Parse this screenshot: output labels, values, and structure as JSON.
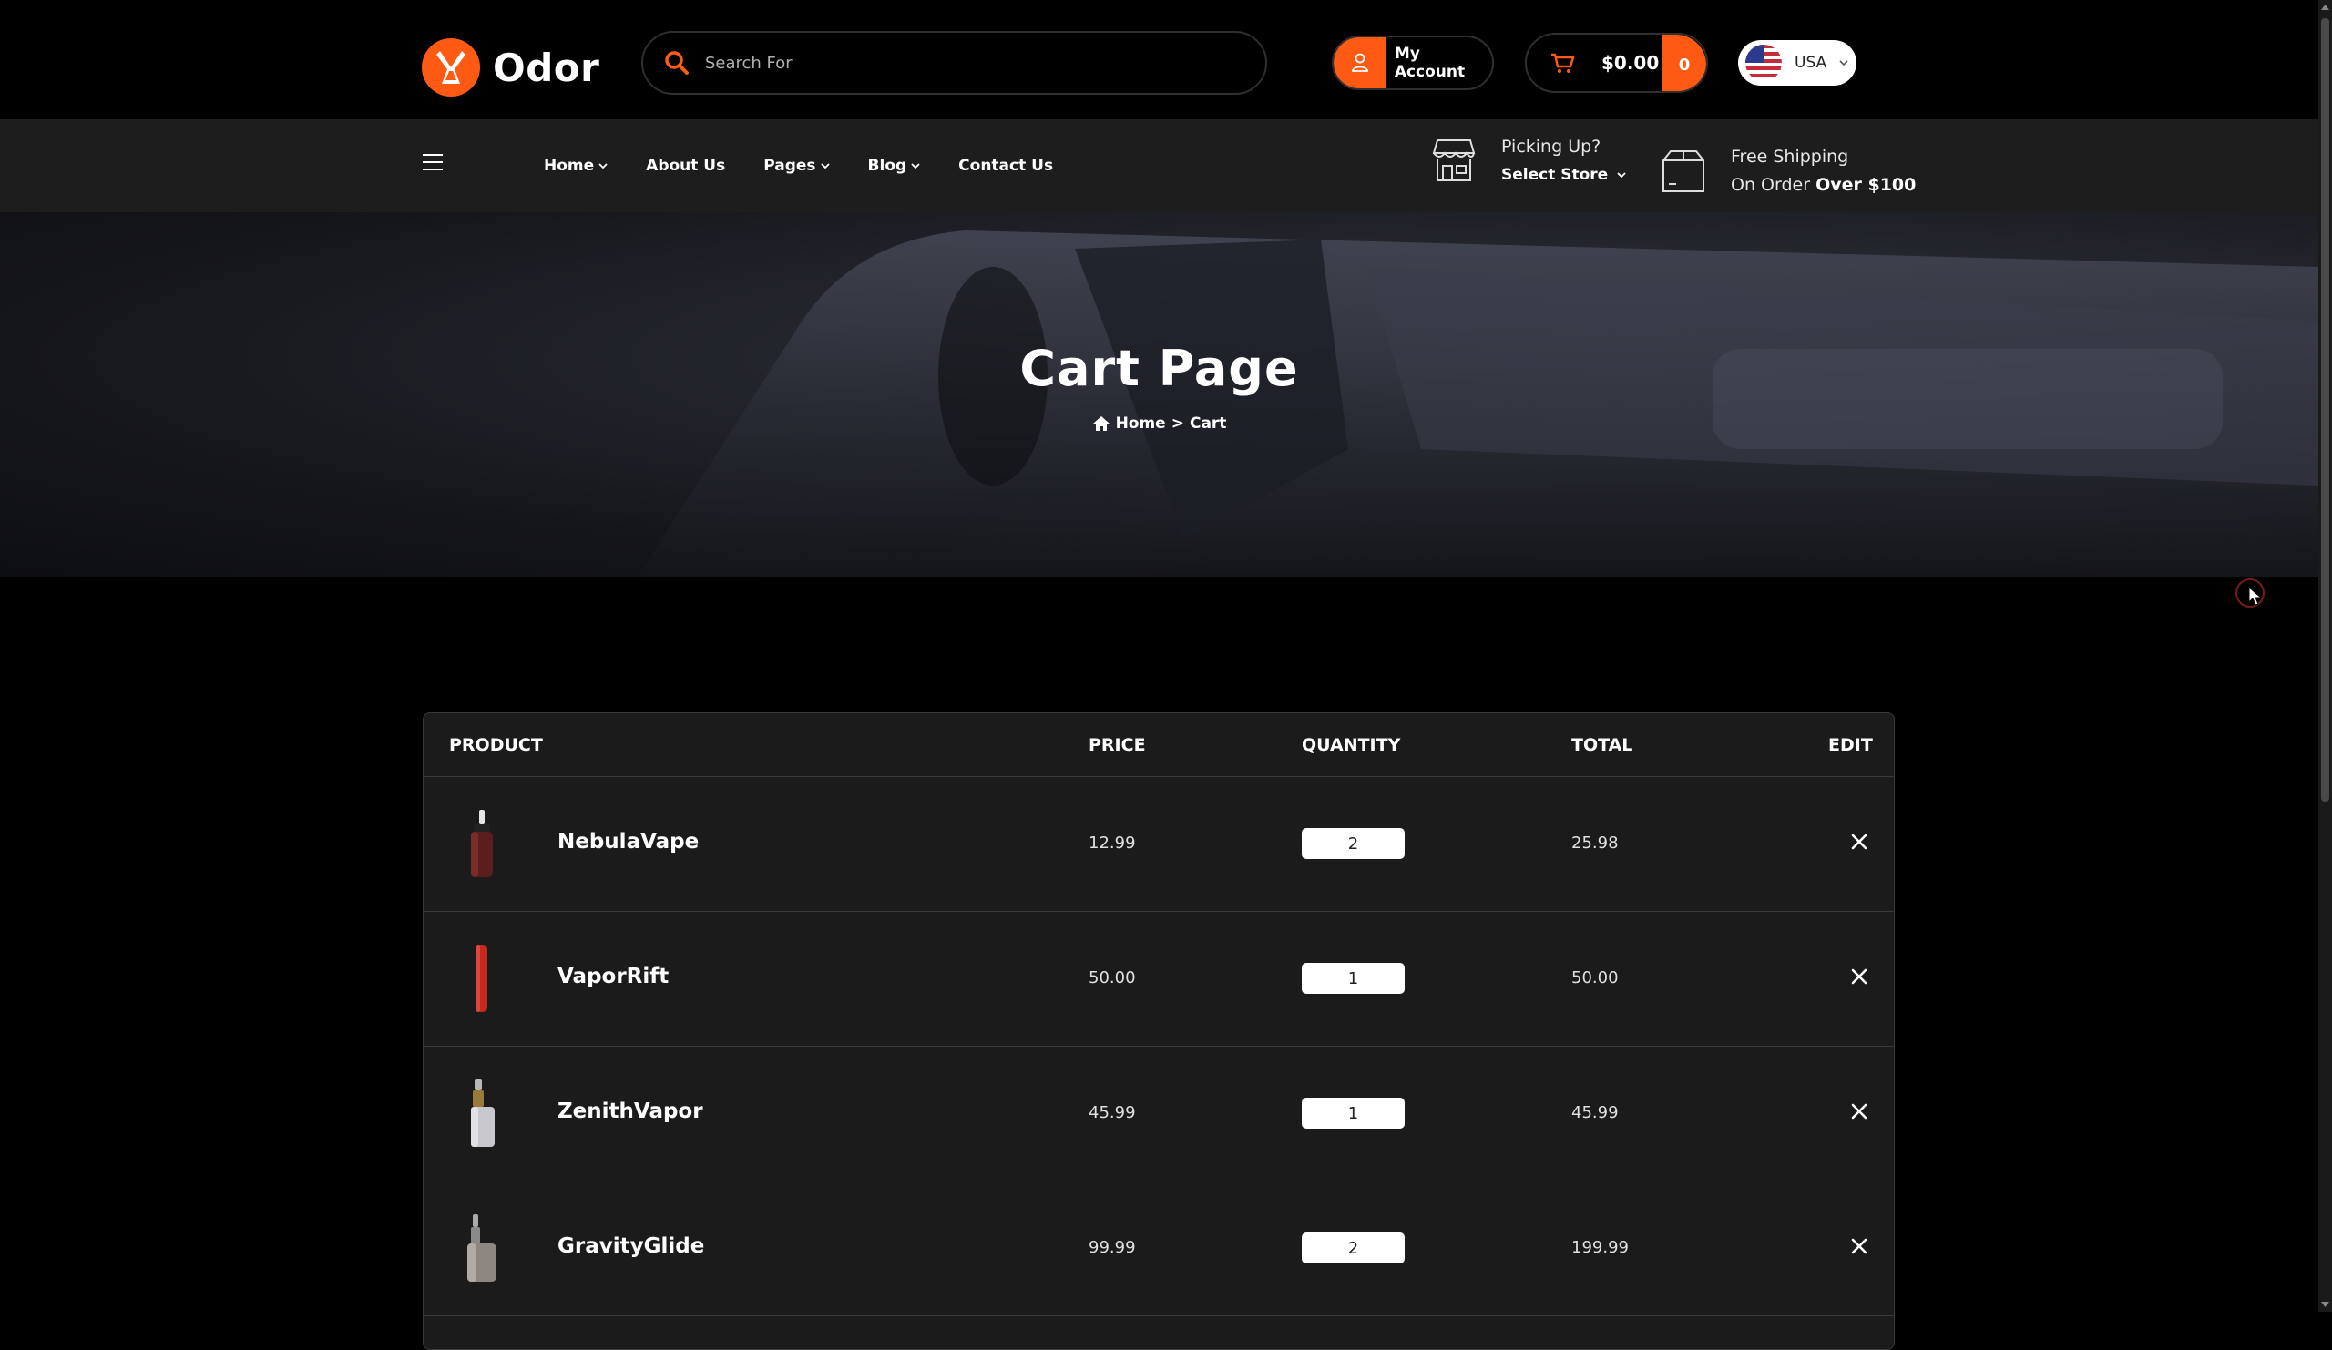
{
  "brand": {
    "name": "Odor",
    "accent": "#ff5a14"
  },
  "search": {
    "placeholder": "Search For",
    "value": ""
  },
  "account": {
    "label": "My Account"
  },
  "cart": {
    "total": "$0.00",
    "count": "0"
  },
  "currency": {
    "label": "USA"
  },
  "nav": {
    "items": [
      {
        "label": "Home",
        "dropdown": true
      },
      {
        "label": "About Us",
        "dropdown": false
      },
      {
        "label": "Pages",
        "dropdown": true
      },
      {
        "label": "Blog",
        "dropdown": true
      },
      {
        "label": "Contact Us",
        "dropdown": false
      }
    ]
  },
  "pickup": {
    "line1": "Picking Up?",
    "line2": "Select Store"
  },
  "shipping": {
    "line1": "Free Shipping",
    "line2_prefix": "On Order",
    "line2_bold": "Over $100"
  },
  "hero": {
    "title": "Cart Page",
    "breadcrumb": {
      "home": "Home",
      "separator": ">",
      "current": "Cart"
    }
  },
  "table": {
    "headers": {
      "product": "PRODUCT",
      "price": "PRICE",
      "quantity": "QUANTITY",
      "total": "TOTAL",
      "edit": "EDIT"
    },
    "rows": [
      {
        "name": "NebulaVape",
        "price": "12.99",
        "qty": "2",
        "total": "25.98",
        "thumb": "dark-red-vape"
      },
      {
        "name": "VaporRift",
        "price": "50.00",
        "qty": "1",
        "total": "50.00",
        "thumb": "red-vape-pen"
      },
      {
        "name": "ZenithVapor",
        "price": "45.99",
        "qty": "1",
        "total": "45.99",
        "thumb": "silver-vape"
      },
      {
        "name": "GravityGlide",
        "price": "99.99",
        "qty": "2",
        "total": "199.99",
        "thumb": "box-mod-vape"
      }
    ]
  }
}
